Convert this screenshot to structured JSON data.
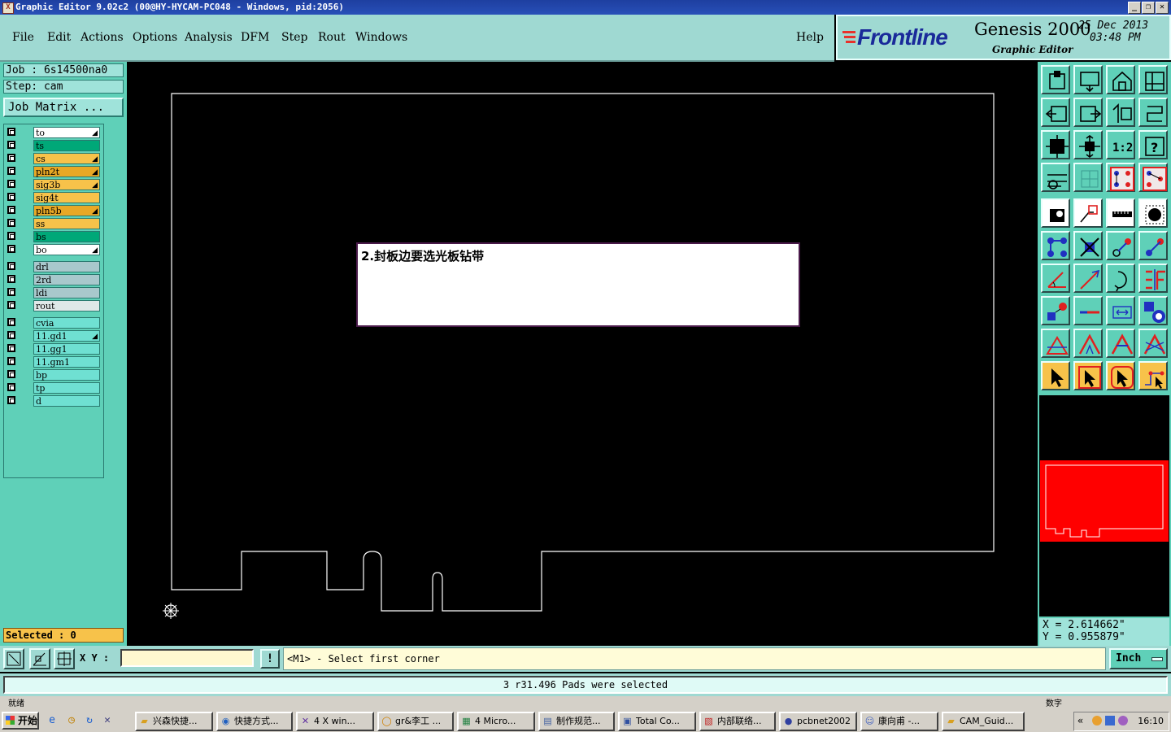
{
  "window": {
    "title": "Graphic Editor 9.02c2 (00@HY-HYCAM-PC048 - Windows, pid:2056)",
    "app_icon_glyph": "X",
    "controls": [
      "_",
      "❐",
      "✕"
    ]
  },
  "menu": {
    "items": [
      "File",
      "Edit",
      "Actions",
      "Options",
      "Analysis",
      "DFM",
      "Step",
      "Rout",
      "Windows"
    ],
    "help": "Help"
  },
  "brand": {
    "logo_text": "Frontline",
    "product": "Genesis 2000",
    "subtitle": "Graphic Editor",
    "date": "25 Dec 2013",
    "time": "03:48 PM",
    "logo_color": "#1a2a9a",
    "logo_mark_color": "#e8312a"
  },
  "job": {
    "job_label": "Job  :  6s14500na0",
    "step_label": "Step:  cam",
    "job_matrix_button": "Job Matrix ..."
  },
  "layers": {
    "groups": [
      [
        {
          "name": "to",
          "color": "#ffffff",
          "arrow": true
        },
        {
          "name": "ts",
          "color": "#00a878",
          "arrow": false
        },
        {
          "name": "cs",
          "color": "#f7c24a",
          "arrow": true
        },
        {
          "name": "pln2t",
          "color": "#e8a826",
          "arrow": true
        },
        {
          "name": "sig3b",
          "color": "#f7c24a",
          "arrow": true
        },
        {
          "name": "sig4t",
          "color": "#f7c24a",
          "arrow": false
        },
        {
          "name": "pln5b",
          "color": "#e8a826",
          "arrow": true
        },
        {
          "name": "ss",
          "color": "#f7c24a",
          "arrow": false
        },
        {
          "name": "bs",
          "color": "#00a878",
          "arrow": false
        },
        {
          "name": "bo",
          "color": "#ffffff",
          "arrow": true
        }
      ],
      [
        {
          "name": "drl",
          "color": "#a8c8cc",
          "arrow": false
        },
        {
          "name": "2rd",
          "color": "#a8c8cc",
          "arrow": false
        },
        {
          "name": "ldi",
          "color": "#a8c8cc",
          "arrow": false
        },
        {
          "name": "rout",
          "color": "#dfe8e8",
          "arrow": false
        }
      ],
      [
        {
          "name": "cvia",
          "color": "#6fe0d2",
          "arrow": false
        },
        {
          "name": "11.gd1",
          "color": "#6fe0d2",
          "arrow": true
        },
        {
          "name": "11.gg1",
          "color": "#6fe0d2",
          "arrow": false
        },
        {
          "name": "11.gm1",
          "color": "#6fe0d2",
          "arrow": false
        },
        {
          "name": "bp",
          "color": "#6fe0d2",
          "arrow": false
        },
        {
          "name": "tp",
          "color": "#6fe0d2",
          "arrow": false
        },
        {
          "name": "d",
          "color": "#6fe0d2",
          "arrow": false
        }
      ]
    ],
    "arrow_glyph": "◢"
  },
  "selected": "Selected : 0",
  "canvas": {
    "message": "2.封板边要选光板钻带",
    "outline_color": "#ffffff",
    "background": "#000000",
    "origin_icon": "origin-crosshair-icon"
  },
  "toolbar": {
    "buttons": [
      "zoom-home-icon",
      "zoom-in-icon",
      "home-icon",
      "split-view-icon",
      "pan-left-icon",
      "pan-right-icon",
      "undo-zoom-icon",
      "snap-icon",
      "fit-icon",
      "center-icon",
      "scale-1-2-icon",
      "help-icon",
      "measure-icon",
      "grid-icon",
      "layer-compare-icon",
      "layer-compare-2-icon",
      "pad-icon",
      "polygon-icon",
      "ruler-icon",
      "round-pad-icon",
      "connect-icon",
      "cross-icon",
      "line-node-icon",
      "line-arrow-icon",
      "angle-icon",
      "slash-icon",
      "arc-icon",
      "split-f-icon",
      "pad-node-icon",
      "line-icon",
      "dimension-icon",
      "shapes-icon",
      "triangle-icon",
      "triangle-arrow-icon",
      "a-shape-icon",
      "a-cross-icon",
      "pointer-icon",
      "pointer-box-icon",
      "pointer-round-icon",
      "pointer-path-icon"
    ],
    "scale_label": "1:2"
  },
  "preview": {
    "fill": "#ff0000",
    "outline": "#ffffff"
  },
  "coords": {
    "x": "X  = 2.614662\"",
    "y": "Y  = 0.955879\""
  },
  "cmdbar": {
    "xy_label": "X Y :",
    "xy_value": "",
    "bang": "!",
    "prompt": "<M1> - Select first corner",
    "unit": "Inch"
  },
  "status": "3 r31.496 Pads were selected",
  "taskbar": {
    "top_left_text": "就绪",
    "top_right_text": "数字",
    "start": "开始",
    "quicklaunch": [
      "ie-icon",
      "clock-icon",
      "refresh-icon",
      "close-x-icon"
    ],
    "tasks": [
      {
        "label": "兴森快捷...",
        "icon": "folder-icon"
      },
      {
        "label": "快捷方式...",
        "icon": "shortcut-icon"
      },
      {
        "label": "4 X win...",
        "icon": "x-window-icon"
      },
      {
        "label": "gr&李工 ...",
        "icon": "chat-icon"
      },
      {
        "label": "4 Micro...",
        "icon": "excel-icon"
      },
      {
        "label": "制作规范...",
        "icon": "doc-icon"
      },
      {
        "label": "Total Co...",
        "icon": "disk-icon"
      },
      {
        "label": "内部联络...",
        "icon": "pdf-icon"
      },
      {
        "label": "pcbnet2002",
        "icon": "globe-icon"
      },
      {
        "label": "康向甫 -...",
        "icon": "person-icon"
      },
      {
        "label": "CAM_Guid...",
        "icon": "folder-icon"
      }
    ],
    "clock": "16:10",
    "tray_chevron": "«"
  }
}
